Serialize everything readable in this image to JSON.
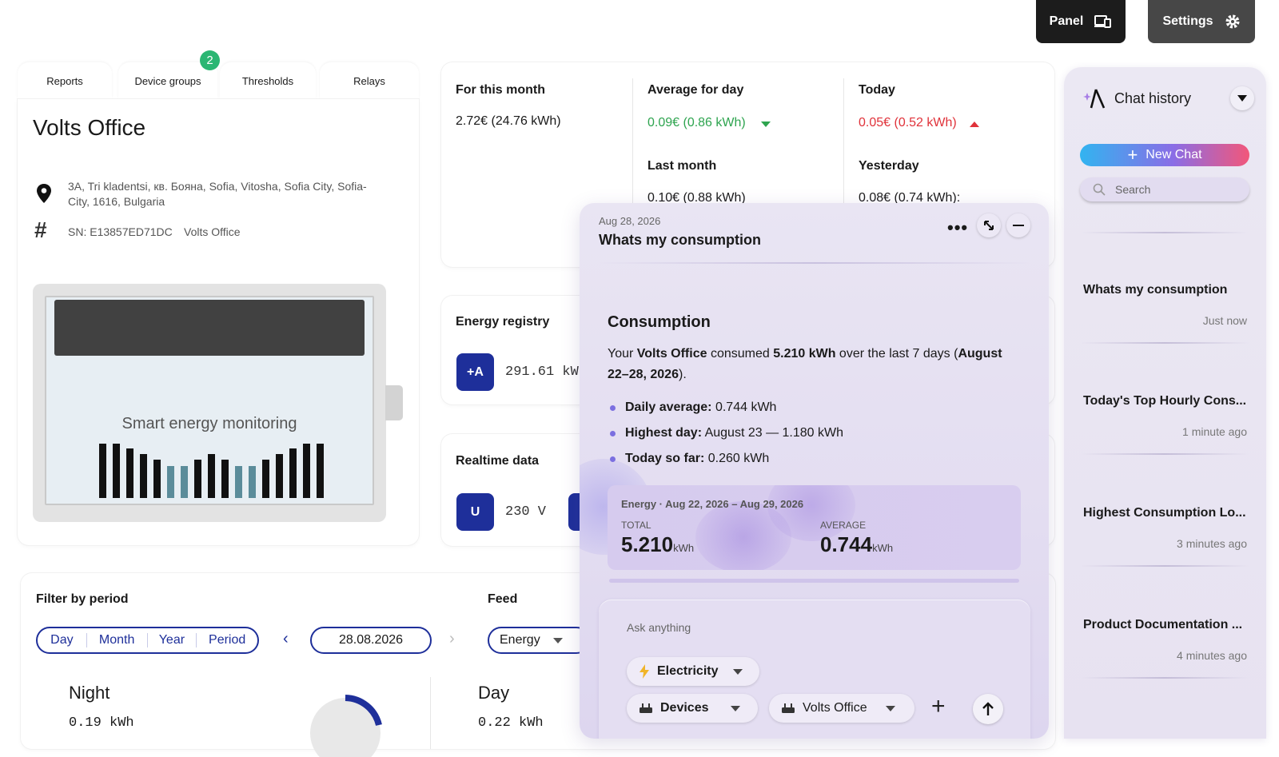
{
  "header": {
    "panel_label": "Panel",
    "settings_label": "Settings"
  },
  "tabs": [
    {
      "label": "Reports"
    },
    {
      "label": "Device groups",
      "badge": "2"
    },
    {
      "label": "Thresholds"
    },
    {
      "label": "Relays"
    }
  ],
  "device": {
    "name": "Volts Office",
    "address": "3A, Tri kladentsi, кв. Бояна, Sofia, Vitosha, Sofia City, Sofia-City, 1616, Bulgaria",
    "sn": "SN: E13857ED71DC",
    "sn_name": "Volts Office",
    "meter_caption": "Smart energy monitoring",
    "meter_bars": [
      1,
      1,
      1,
      1,
      1,
      0,
      0,
      1,
      1,
      1,
      0,
      0,
      1,
      1,
      1,
      1,
      1
    ]
  },
  "summary": {
    "month_label": "For this month",
    "month_value": "2.72€ (24.76 kWh)",
    "avg_label": "Average for day",
    "avg_value": "0.09€ (0.86 kWh)",
    "today_label": "Today",
    "today_value": "0.05€ (0.52 kWh)",
    "last_month_label": "Last month",
    "last_month_value": "0.10€ (0.88 kWh)",
    "yesterday_label": "Yesterday",
    "yesterday_value": "0.08€ (0.74 kWh):"
  },
  "registry": {
    "title": "Energy registry",
    "badge": "+A",
    "value": "291.61 kW"
  },
  "realtime": {
    "title": "Realtime data",
    "badge": "U",
    "value": "230 V"
  },
  "filter": {
    "title": "Filter by period",
    "options": [
      "Day",
      "Month",
      "Year",
      "Period"
    ],
    "date": "28.08.2026",
    "feed_label": "Feed",
    "feed_value": "Energy"
  },
  "tariffs": {
    "night_label": "Night",
    "night_value": "0.19 kWh",
    "day_label": "Day",
    "day_value": "0.22 kWh"
  },
  "chat_window": {
    "date": "Aug 28, 2026",
    "title": "Whats my consumption",
    "heading": "Consumption",
    "msg_prefix": "Your ",
    "msg_device": "Volts Office",
    "msg_mid": " consumed ",
    "msg_amount": "5.210 kWh",
    "msg_over": " over the last 7 days (",
    "msg_range": "August 22–28, 2026",
    "msg_end": ").",
    "bullets": [
      {
        "label": "Daily average:",
        "value": " 0.744 kWh"
      },
      {
        "label": "Highest day:",
        "value": " August 23 — 1.180 kWh"
      },
      {
        "label": "Today so far:",
        "value": " 0.260 kWh"
      }
    ],
    "widget_title": "Energy · Aug 22, 2026 – Aug 29, 2026",
    "total_label": "TOTAL",
    "total_value": "5.210",
    "total_unit": "kWh",
    "avg_label": "AVERAGE",
    "avg_value": "0.744",
    "avg_unit": "kWh",
    "input_placeholder": "Ask anything",
    "chip_electricity": "Electricity",
    "chip_devices": "Devices",
    "chip_office": "Volts Office"
  },
  "chat_history": {
    "title": "Chat history",
    "new_chat": "New Chat",
    "search_placeholder": "Search",
    "items": [
      {
        "title": "Whats my consumption",
        "time": "Just now"
      },
      {
        "title": "Today's Top Hourly Cons...",
        "time": "1 minute ago"
      },
      {
        "title": "Highest Consumption Lo...",
        "time": "3 minutes ago"
      },
      {
        "title": "Product Documentation ...",
        "time": "4 minutes ago"
      }
    ]
  },
  "colors": {
    "navy": "#1e2f9a",
    "green": "#2ea44f",
    "red": "#e0323a",
    "badge_green": "#2bb673"
  }
}
